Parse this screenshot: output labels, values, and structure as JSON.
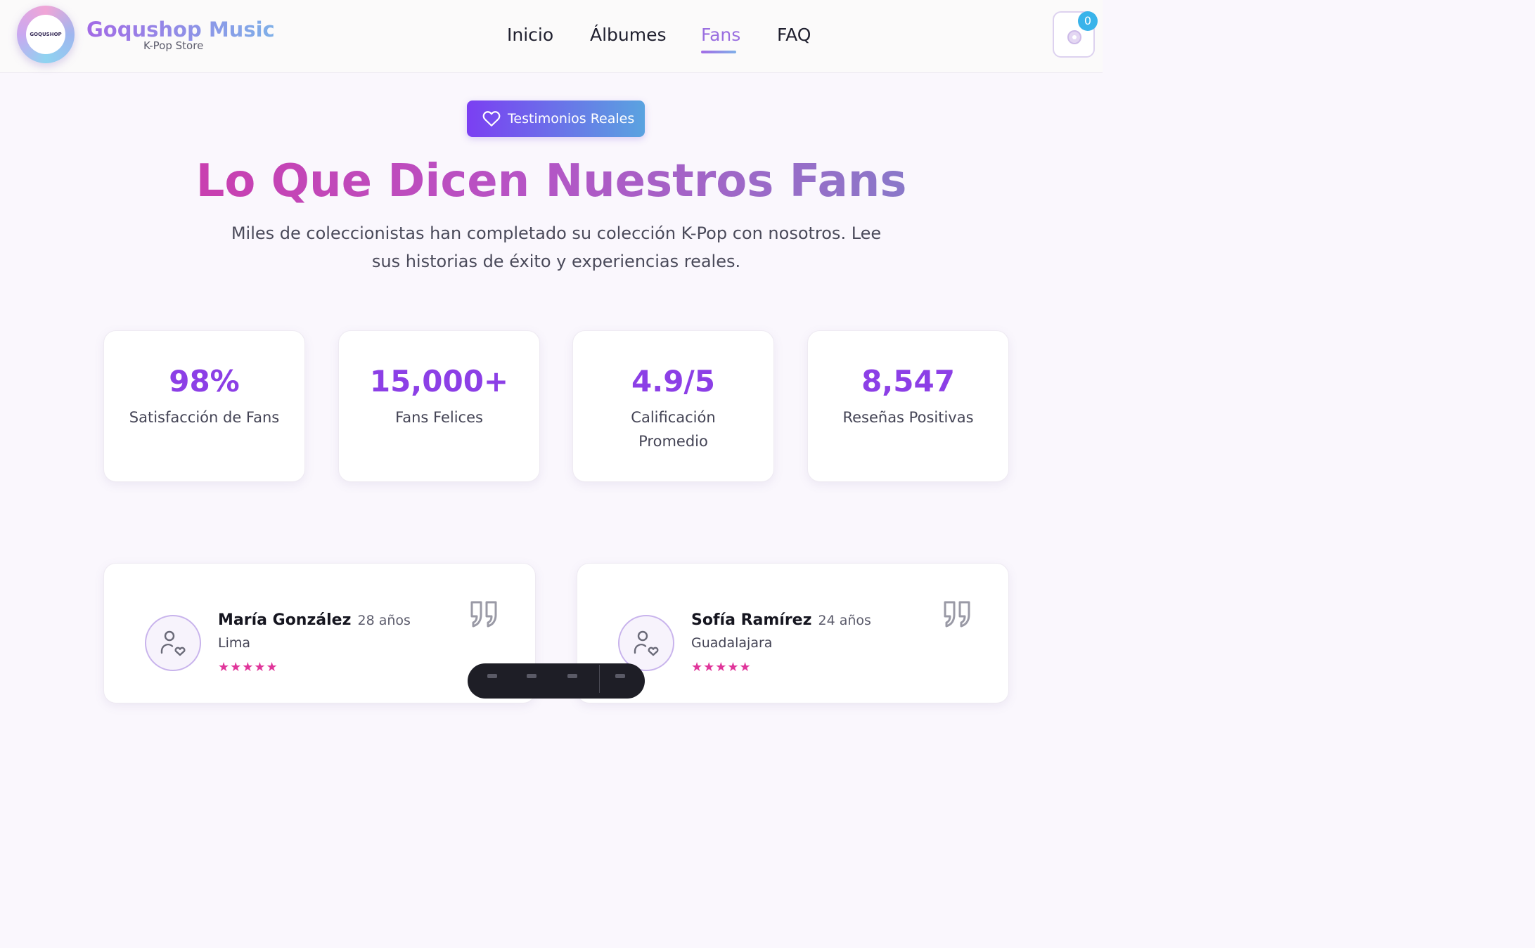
{
  "header": {
    "brand_title": "Goqushop Music",
    "brand_subtitle": "K-Pop Store",
    "logo_text": "GOQUSHOP",
    "nav": [
      {
        "label": "Inicio",
        "active": false
      },
      {
        "label": "Álbumes",
        "active": false
      },
      {
        "label": "Fans",
        "active": true
      },
      {
        "label": "FAQ",
        "active": false
      }
    ],
    "cart_count": "0",
    "accent_color": "#9a6fe0"
  },
  "hero": {
    "badge_label": "Testimonios Reales",
    "badge_icon": "heart-icon",
    "title": "Lo Que Dicen Nuestros Fans",
    "description": "Miles de coleccionistas han completado su colección K-Pop con nosotros. Lee sus historias de éxito y experiencias reales."
  },
  "stats": [
    {
      "value": "98%",
      "label": "Satisfacción de Fans"
    },
    {
      "value": "15,000+",
      "label": "Fans Felices"
    },
    {
      "value": "4.9/5",
      "label": "Calificación Promedio"
    },
    {
      "value": "8,547",
      "label": "Reseñas Positivas"
    }
  ],
  "testimonials": [
    {
      "name": "María González",
      "age": "28 años",
      "city": "Lima",
      "stars": "★★★★★",
      "rating": 5
    },
    {
      "name": "Sofía Ramírez",
      "age": "24 años",
      "city": "Guadalajara",
      "stars": "★★★★★",
      "rating": 5
    }
  ]
}
